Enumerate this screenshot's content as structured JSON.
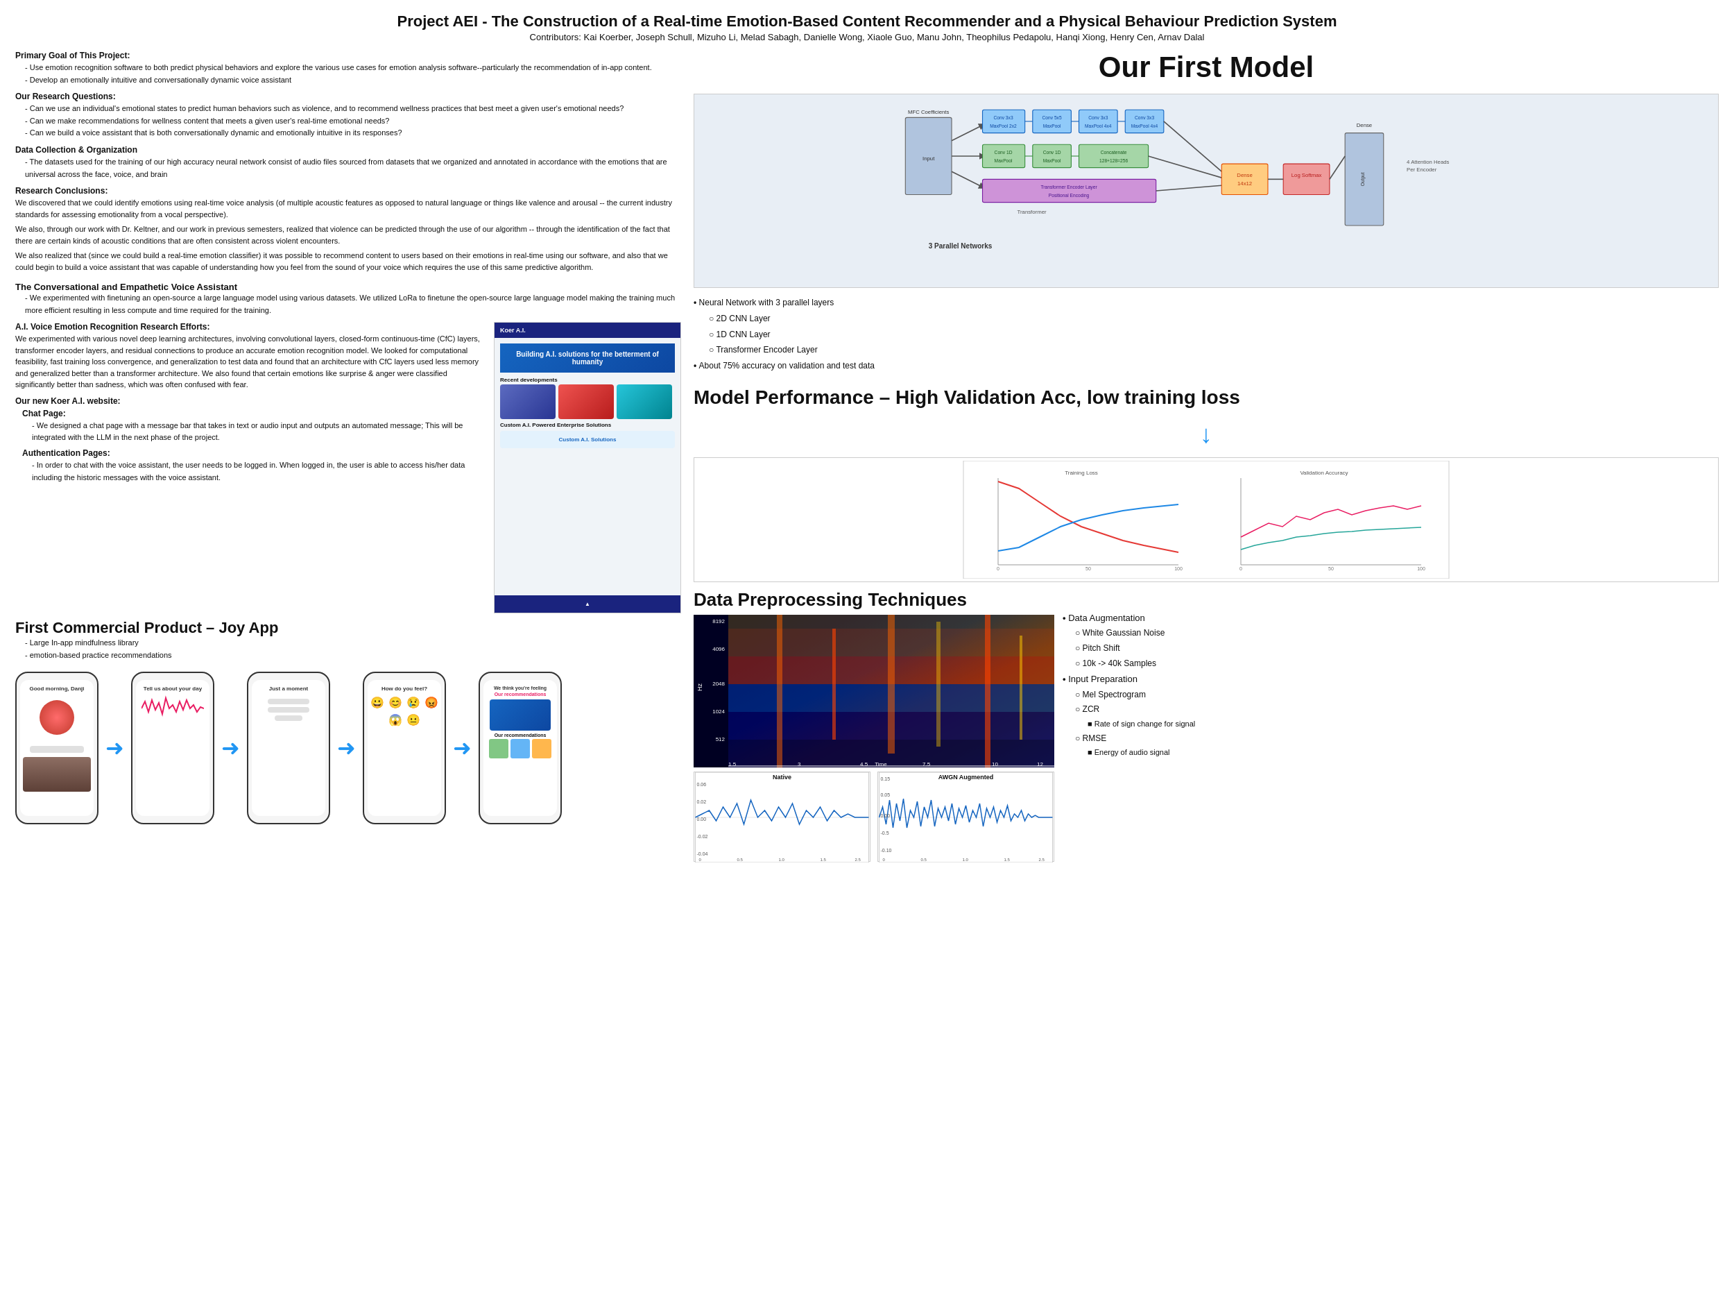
{
  "header": {
    "title": "Project AEI - The Construction of a Real-time Emotion-Based Content Recommender and a Physical Behaviour Prediction System",
    "contributors": "Contributors: Kai Koerber, Joseph Schull, Mizuho Li, Melad Sabagh, Danielle Wong, Xiaole Guo, Manu John, Theophilus Pedapolu, Hanqi Xiong, Henry Cen, Arnav Dalal"
  },
  "left": {
    "primary_goal_heading": "Primary Goal of This Project:",
    "primary_goal_items": [
      "Use emotion recognition software to both predict physical behaviors and explore the various use cases for emotion analysis software--particularly the recommendation of in-app content.",
      "Develop an emotionally intuitive and conversationally dynamic voice assistant"
    ],
    "research_q_heading": "Our Research Questions:",
    "research_q_items": [
      "Can we use an individual's emotional states to predict human behaviors such as violence, and to recommend wellness practices that best meet a given user's emotional needs?",
      "Can we make recommendations for wellness content that meets a given user's real-time emotional needs?",
      "Can we build a voice assistant that is both conversationally dynamic and emotionally intuitive in its responses?"
    ],
    "data_collection_heading": "Data Collection & Organization",
    "data_collection_items": [
      "The datasets used for the training of our high accuracy neural network consist of audio files sourced from datasets that we organized and annotated in accordance with the emotions that are universal across the face, voice, and brain"
    ],
    "research_conclusions_heading": "Research Conclusions:",
    "research_conclusions_text": [
      "We discovered that we could identify emotions using real-time voice analysis (of multiple acoustic features as opposed to natural language or things like valence and arousal -- the current industry standards for assessing emotionality from a vocal perspective).",
      "We also, through our work with Dr. Keltner, and our work in previous semesters, realized that violence can be predicted through the use of our algorithm -- through the identification of the fact that there are certain kinds of acoustic conditions that are often consistent across violent encounters.",
      "We also realized that (since we could build a real-time emotion classifier) it was possible to recommend content to users based on their emotions in real-time using our software, and also that we could begin to build a voice assistant that was capable of understanding how you feel from the sound of your voice which requires the use of this same predictive algorithm."
    ],
    "voice_assistant_heading": "The Conversational and Empathetic Voice Assistant",
    "voice_assistant_items": [
      "We experimented with finetuning an open-source a large language model using various datasets. We utilized LoRa to finetune the open-source large language model making the training much more efficient resulting in less compute and time required for the training."
    ],
    "ai_voice_heading": "A.I. Voice Emotion Recognition Research Efforts:",
    "ai_voice_text": "We experimented with various novel deep learning architectures, involving convolutional layers, closed-form continuous-time (CfC) layers, transformer encoder layers, and residual connections to produce an accurate emotion recognition model. We looked for computational feasibility, fast training loss convergence, and generalization to test data and found that an architecture with CfC layers used less memory and generalized better than a transformer architecture. We also found that certain emotions like surprise & anger were classified significantly better than sadness, which was often confused with fear.",
    "website_heading": "Our new Koer A.I. website:",
    "chat_page_heading": "Chat Page:",
    "chat_page_text": "We designed a chat page with a message bar that takes in text or audio input and outputs an automated message; This will be integrated with the LLM in the next phase of the project.",
    "auth_page_heading": "Authentication Pages:",
    "auth_page_text": "In order to chat with the voice assistant, the user needs to be logged in. When logged in, the user is able to access his/her data including the historic messages with the voice assistant.",
    "commercial_title": "First Commercial Product – Joy App",
    "commercial_items": [
      "Large In-app mindfulness library",
      "emotion-based practice recommendations"
    ],
    "website": {
      "header_text": "Koer A.I.",
      "hero_text": "Building A.I. solutions for the betterment of humanity",
      "recent_label": "Recent developments",
      "custom_label": "Custom A.I. Powered Enterprise Solutions"
    }
  },
  "right": {
    "first_model_title": "Our First Model",
    "nn_bullets": [
      {
        "level": 1,
        "text": "Neural Network with 3 parallel layers"
      },
      {
        "level": 2,
        "text": "2D CNN Layer"
      },
      {
        "level": 2,
        "text": "1D CNN Layer"
      },
      {
        "level": 2,
        "text": "Transformer Encoder Layer"
      },
      {
        "level": 1,
        "text": "About 75% accuracy on validation and test data"
      }
    ],
    "model_perf_title": "Model Performance – High Validation Acc, low training loss",
    "data_prep_title": "Data Preprocessing Techniques",
    "data_prep_items": [
      {
        "level": 1,
        "text": "Data Augmentation"
      },
      {
        "level": 2,
        "text": "White Gaussian Noise"
      },
      {
        "level": 2,
        "text": "Pitch Shift"
      },
      {
        "level": 2,
        "text": "10k -> 40k Samples"
      },
      {
        "level": 1,
        "text": "Input Preparation"
      },
      {
        "level": 2,
        "text": "Mel Spectrogram"
      },
      {
        "level": 2,
        "text": "ZCR"
      },
      {
        "level": 3,
        "text": "Rate of sign change for signal"
      },
      {
        "level": 2,
        "text": "RMSE"
      },
      {
        "level": 3,
        "text": "Energy of audio signal"
      }
    ],
    "spec_y_labels": [
      "8192",
      "4096",
      "2048",
      "1024",
      "512"
    ],
    "spec_x_label": "Time",
    "waveform_left_title": "Native",
    "waveform_right_title": "AWGN Augmented",
    "phones": [
      {
        "screen_text": "Good morning, Danji",
        "sub_text": ""
      },
      {
        "screen_text": "Tell us about your day",
        "sub_text": ""
      },
      {
        "screen_text": "Just a moment",
        "sub_text": ""
      },
      {
        "screen_text": "How do you feel?",
        "sub_text": ""
      },
      {
        "screen_text": "We think you're feeling",
        "sub_text": "Our recommendations"
      }
    ]
  }
}
